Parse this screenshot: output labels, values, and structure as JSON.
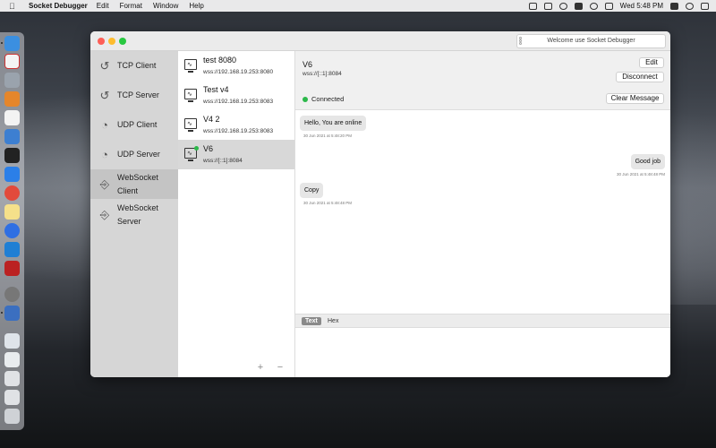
{
  "menubar": {
    "app_name": "Socket Debugger",
    "menus": [
      "Edit",
      "Format",
      "Window",
      "Help"
    ],
    "clock": "Wed 5:48 PM"
  },
  "window": {
    "title_field": "Welcome use Socket Debugger"
  },
  "sidebar": {
    "items": [
      {
        "label": "TCP Client",
        "icon": "tcp-icon"
      },
      {
        "label": "TCP Server",
        "icon": "tcp-icon"
      },
      {
        "label": "UDP Client",
        "icon": "udp-icon"
      },
      {
        "label": "UDP Server",
        "icon": "udp-icon"
      },
      {
        "label_line1": "WebSocket",
        "label_line2": "Client",
        "icon": "websocket-icon"
      },
      {
        "label_line1": "WebSocket",
        "label_line2": "Server",
        "icon": "websocket-icon"
      }
    ]
  },
  "connections": [
    {
      "name": "test 8080",
      "url": "wss://192.168.19.253:8080"
    },
    {
      "name": "Test v4",
      "url": "wss://192.168.19.253:8083"
    },
    {
      "name": "V4 2",
      "url": "wss://192.168.19.253:8083"
    },
    {
      "name": "V6",
      "url": "wss://[::1]:8084"
    }
  ],
  "list_footer": {
    "add": "+",
    "remove": "−"
  },
  "detail": {
    "name": "V6",
    "url": "wss://[::1]:8084",
    "edit_label": "Edit",
    "disconnect_label": "Disconnect",
    "status": "Connected",
    "clear_label": "Clear Message",
    "status_color": "#2bb84a"
  },
  "messages": [
    {
      "text": "Hello, You are online",
      "time": "30 Jun 2021 at 5:48:20 PM",
      "side": "left"
    },
    {
      "text": "Good job",
      "time": "30 Jun 2021 at 5:48:48 PM",
      "side": "right"
    },
    {
      "text": "Copy",
      "time": "30 Jun 2021 at 5:48:48 PM",
      "side": "left"
    }
  ],
  "input_tabs": {
    "text": "Text",
    "hex": "Hex"
  }
}
